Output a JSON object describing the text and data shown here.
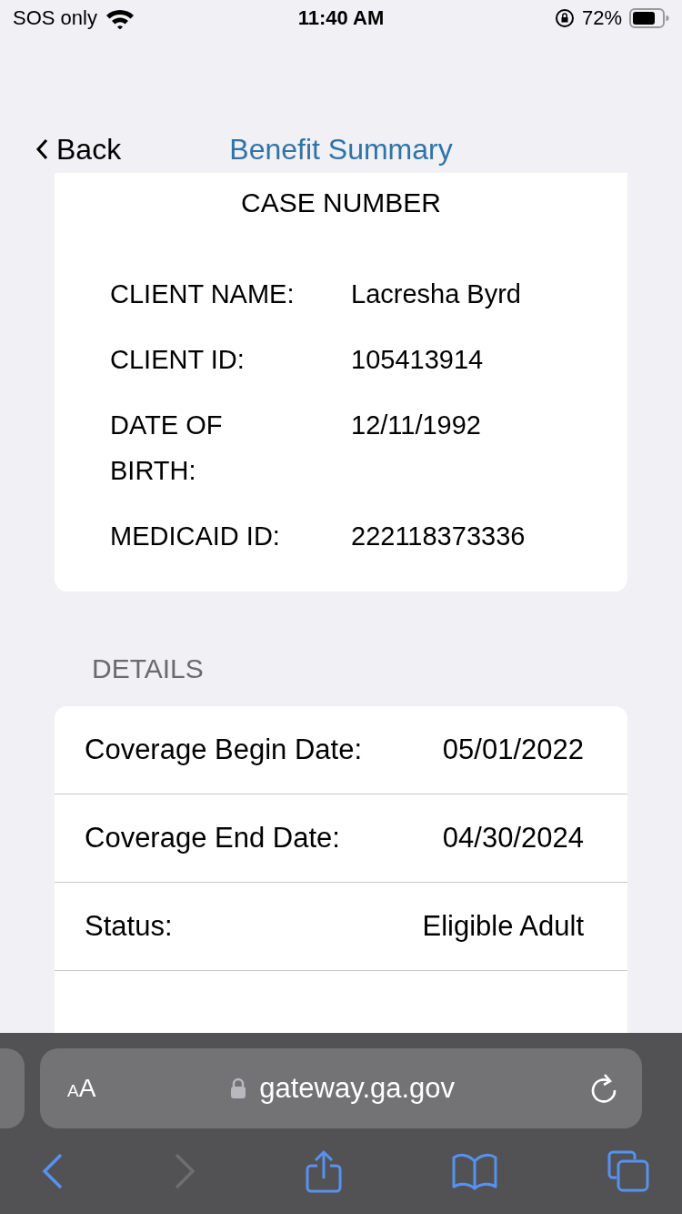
{
  "status_bar": {
    "carrier": "SOS only",
    "time": "11:40 AM",
    "battery": "72%"
  },
  "nav": {
    "back": "Back",
    "title": "Benefit Summary"
  },
  "case_card": {
    "heading": "CASE NUMBER",
    "fields": [
      {
        "label": "CLIENT NAME:",
        "value": "Lacresha Byrd"
      },
      {
        "label": "CLIENT ID:",
        "value": "105413914"
      },
      {
        "label": "DATE OF BIRTH:",
        "value": "12/11/1992"
      },
      {
        "label": "MEDICAID ID:",
        "value": "222118373336"
      }
    ]
  },
  "details": {
    "heading": "DETAILS",
    "rows": [
      {
        "label": "Coverage Begin Date:",
        "value": "05/01/2022"
      },
      {
        "label": "Coverage End Date:",
        "value": "04/30/2024"
      },
      {
        "label": "Status:",
        "value": "Eligible Adult"
      }
    ]
  },
  "browser": {
    "text_size": "AA",
    "url": "gateway.ga.gov",
    "toolbar": [
      {
        "kind": "back",
        "disabled": false
      },
      {
        "kind": "forward",
        "disabled": true
      },
      {
        "kind": "share",
        "disabled": false
      },
      {
        "kind": "bookmarks",
        "disabled": false
      },
      {
        "kind": "tabs",
        "disabled": false
      }
    ]
  }
}
